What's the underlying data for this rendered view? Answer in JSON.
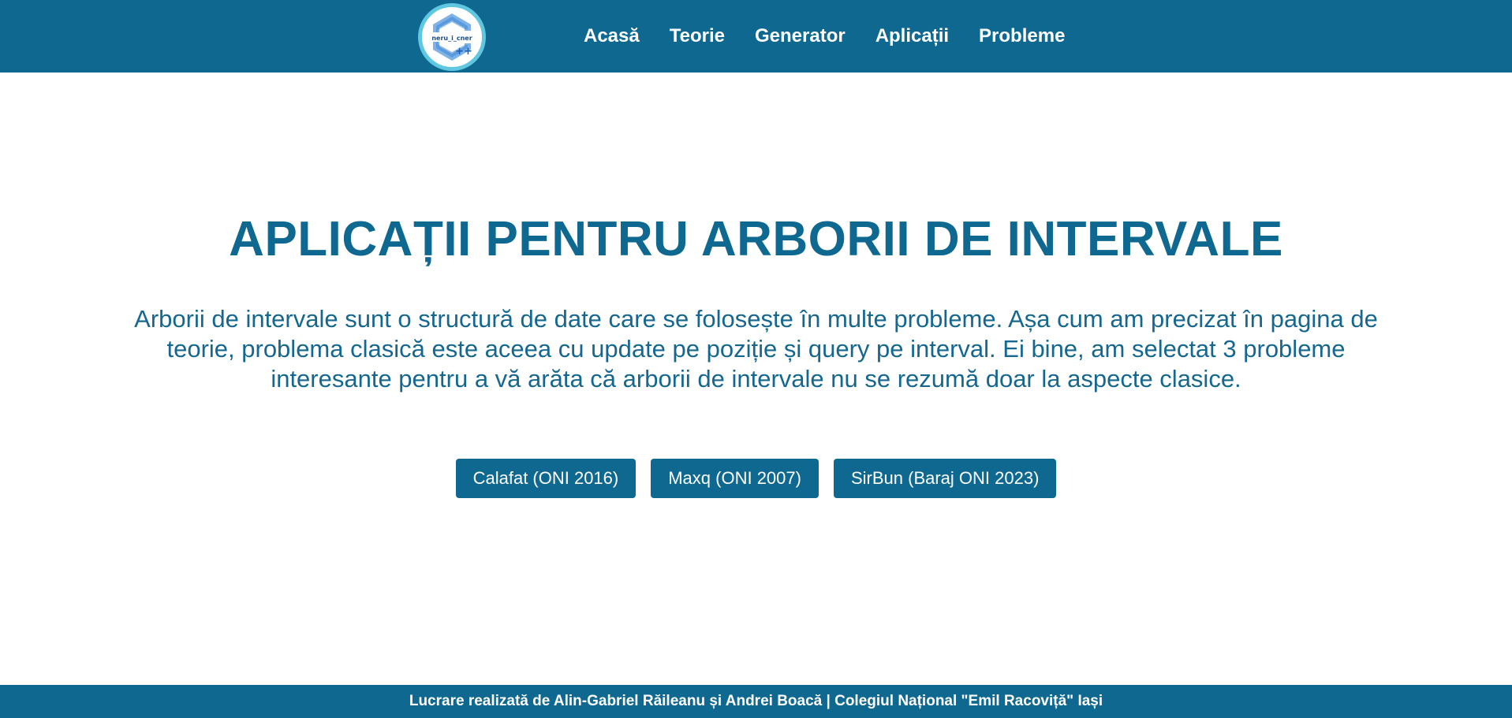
{
  "header": {
    "logo_text": "neru_i_cner",
    "logo_icon": "c-plus-plus-logo-icon",
    "nav": [
      {
        "label": "Acasă"
      },
      {
        "label": "Teorie"
      },
      {
        "label": "Generator"
      },
      {
        "label": "Aplicații"
      },
      {
        "label": "Probleme"
      }
    ]
  },
  "main": {
    "title": "APLICAȚII PENTRU ARBORII DE INTERVALE",
    "intro": "Arborii de intervale sunt o structură de date care se folosește în multe probleme. Așa cum am precizat în pagina de teorie, problema clasică este aceea cu update pe poziție și query pe interval. Ei bine, am selectat 3 probleme interesante pentru a vă arăta că arborii de intervale nu se rezumă doar la aspecte clasice.",
    "buttons": [
      {
        "label": "Calafat (ONI 2016)"
      },
      {
        "label": "Maxq (ONI 2007)"
      },
      {
        "label": "SirBun (Baraj ONI 2023)"
      }
    ]
  },
  "footer": {
    "text": "Lucrare realizată de Alin-Gabriel Răileanu și Andrei Boacă | Colegiul Național \"Emil Racoviță\" Iași"
  },
  "colors": {
    "primary": "#0e6890",
    "text_blue": "#16678f",
    "logo_ring": "#5fc7e0",
    "background": "#ffffff"
  }
}
